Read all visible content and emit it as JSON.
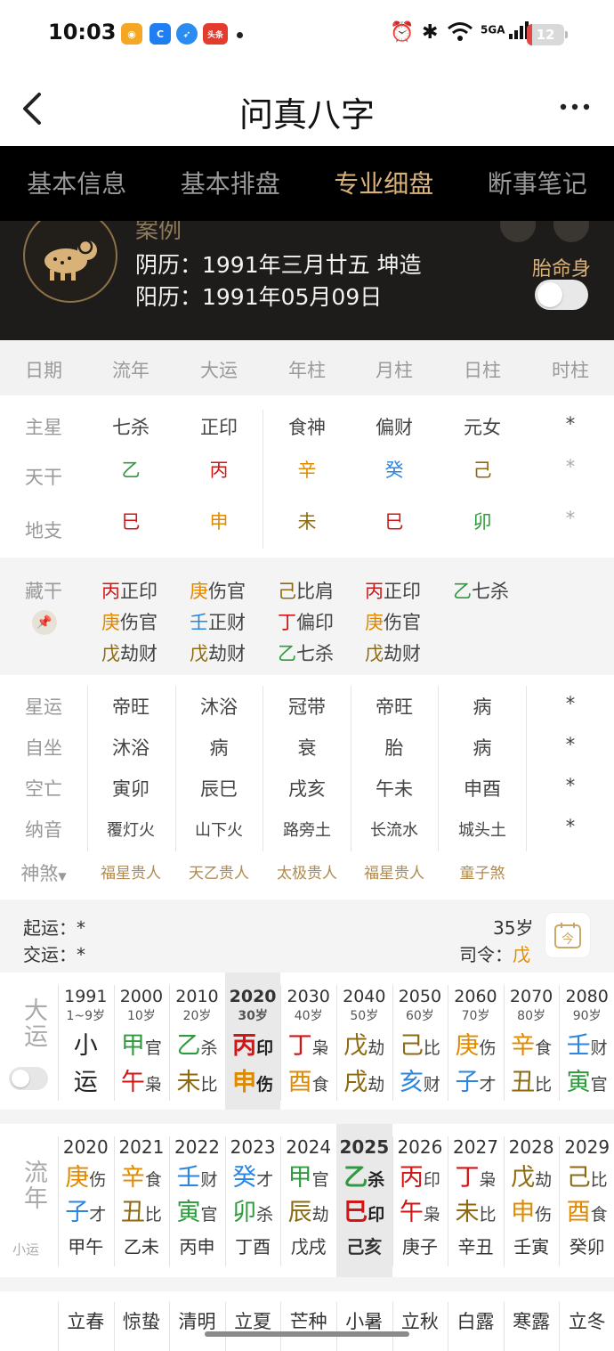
{
  "status_bar": {
    "time": "10:03",
    "apps": [
      {
        "icon": "weibo-icon",
        "color": "#f5a623"
      },
      {
        "icon": "app-c-icon",
        "color": "#1f7ef2"
      },
      {
        "icon": "app-feather-icon",
        "color": "#2a8cf0"
      },
      {
        "icon": "toutiao-icon",
        "color": "#e33b2e",
        "text": "头条"
      }
    ],
    "network": "5GA",
    "battery": "12"
  },
  "nav": {
    "title": "问真八字"
  },
  "tabs": [
    "基本信息",
    "基本排盘",
    "专业细盘",
    "断事笔记"
  ],
  "active_tab": 2,
  "profile": {
    "name": "案例",
    "lunar": "阴历：1991年三月廿五 坤造",
    "solar": "阳历：1991年05月09日",
    "fetal_label": "胎命身",
    "fetal_on": false,
    "zodiac_icon": "ram-icon"
  },
  "columns": [
    "日期",
    "流年",
    "大运",
    "年柱",
    "月柱",
    "日柱",
    "时柱"
  ],
  "row_labels": {
    "main_star": "主星",
    "stem": "天干",
    "branch": "地支",
    "hidden": "藏干"
  },
  "main_star": [
    "七杀",
    "正印",
    "食神",
    "偏财",
    "元女",
    "*"
  ],
  "stems": [
    {
      "char": "乙",
      "color": "#2f9a3e"
    },
    {
      "char": "丙",
      "color": "#d21616"
    },
    {
      "char": "辛",
      "color": "#e08a00"
    },
    {
      "char": "癸",
      "color": "#2a86e0"
    },
    {
      "char": "己",
      "color": "#8d6a10"
    },
    {
      "char": "*",
      "color": "#aaaaaa"
    }
  ],
  "branches": [
    {
      "char": "巳",
      "color": "#d21616"
    },
    {
      "char": "申",
      "color": "#e08a00"
    },
    {
      "char": "未",
      "color": "#8d6a10"
    },
    {
      "char": "巳",
      "color": "#d21616"
    },
    {
      "char": "卯",
      "color": "#2f9a3e"
    },
    {
      "char": "*",
      "color": "#aaaaaa"
    }
  ],
  "hidden_stems": [
    [
      {
        "c": "丙",
        "t": "正印",
        "color": "#d21616"
      },
      {
        "c": "庚",
        "t": "伤官",
        "color": "#e08a00"
      },
      {
        "c": "戊",
        "t": "劫财",
        "color": "#8d6a10"
      }
    ],
    [
      {
        "c": "庚",
        "t": "伤官",
        "color": "#e08a00"
      },
      {
        "c": "壬",
        "t": "正财",
        "color": "#2a86e0"
      },
      {
        "c": "戊",
        "t": "劫财",
        "color": "#8d6a10"
      }
    ],
    [
      {
        "c": "己",
        "t": "比肩",
        "color": "#8d6a10"
      },
      {
        "c": "丁",
        "t": "偏印",
        "color": "#d21616"
      },
      {
        "c": "乙",
        "t": "七杀",
        "color": "#2f9a3e"
      }
    ],
    [
      {
        "c": "丙",
        "t": "正印",
        "color": "#d21616"
      },
      {
        "c": "庚",
        "t": "伤官",
        "color": "#e08a00"
      },
      {
        "c": "戊",
        "t": "劫财",
        "color": "#8d6a10"
      }
    ],
    [
      {
        "c": "乙",
        "t": "七杀",
        "color": "#2f9a3e"
      }
    ]
  ],
  "star_rows": [
    {
      "label": "星运",
      "values": [
        "帝旺",
        "沐浴",
        "冠带",
        "帝旺",
        "病",
        "*"
      ]
    },
    {
      "label": "自坐",
      "values": [
        "沐浴",
        "病",
        "衰",
        "胎",
        "病",
        "*"
      ]
    },
    {
      "label": "空亡",
      "values": [
        "寅卯",
        "辰巳",
        "戌亥",
        "午未",
        "申酉",
        "*"
      ]
    },
    {
      "label": "纳音",
      "values": [
        "覆灯火",
        "山下火",
        "路旁土",
        "长流水",
        "城头土",
        "*"
      ]
    }
  ],
  "shensha": {
    "label": "神煞",
    "values": [
      "福星贵人",
      "天乙贵人",
      "太极贵人",
      "福星贵人",
      "童子煞"
    ]
  },
  "luck_info": {
    "start_luck": "起运：*",
    "hand_over": "交运：*",
    "age": "35岁",
    "commander_label": "司令：",
    "commander_value": "戊",
    "today_label": "今"
  },
  "dayun": {
    "label": "大运",
    "toggle_on": false,
    "items": [
      {
        "year": "1991",
        "age": "1~9岁",
        "top": "小",
        "bottom": "运",
        "top_color": "#222222",
        "bottom_color": "#222222",
        "top_ss": "",
        "bottom_ss": ""
      },
      {
        "year": "2000",
        "age": "10岁",
        "top": "甲",
        "top_ss": "官",
        "bottom": "午",
        "bottom_ss": "枭",
        "top_color": "#2f9a3e",
        "bottom_color": "#d21616"
      },
      {
        "year": "2010",
        "age": "20岁",
        "top": "乙",
        "top_ss": "杀",
        "bottom": "未",
        "bottom_ss": "比",
        "top_color": "#2f9a3e",
        "bottom_color": "#8d6a10"
      },
      {
        "year": "2020",
        "age": "30岁",
        "top": "丙",
        "top_ss": "印",
        "bottom": "申",
        "bottom_ss": "伤",
        "top_color": "#d21616",
        "bottom_color": "#e08a00",
        "current": true
      },
      {
        "year": "2030",
        "age": "40岁",
        "top": "丁",
        "top_ss": "枭",
        "bottom": "酉",
        "bottom_ss": "食",
        "top_color": "#d21616",
        "bottom_color": "#e08a00"
      },
      {
        "year": "2040",
        "age": "50岁",
        "top": "戊",
        "top_ss": "劫",
        "bottom": "戌",
        "bottom_ss": "劫",
        "top_color": "#8d6a10",
        "bottom_color": "#8d6a10"
      },
      {
        "year": "2050",
        "age": "60岁",
        "top": "己",
        "top_ss": "比",
        "bottom": "亥",
        "bottom_ss": "财",
        "top_color": "#8d6a10",
        "bottom_color": "#2a86e0"
      },
      {
        "year": "2060",
        "age": "70岁",
        "top": "庚",
        "top_ss": "伤",
        "bottom": "子",
        "bottom_ss": "才",
        "top_color": "#e08a00",
        "bottom_color": "#2a86e0"
      },
      {
        "year": "2070",
        "age": "80岁",
        "top": "辛",
        "top_ss": "食",
        "bottom": "丑",
        "bottom_ss": "比",
        "top_color": "#e08a00",
        "bottom_color": "#8d6a10"
      },
      {
        "year": "2080",
        "age": "90岁",
        "top": "壬",
        "top_ss": "财",
        "bottom": "寅",
        "bottom_ss": "官",
        "top_color": "#2a86e0",
        "bottom_color": "#2f9a3e"
      }
    ]
  },
  "liunian": {
    "label": "流年",
    "sub_label": "小运",
    "items": [
      {
        "year": "2020",
        "top": "庚",
        "top_ss": "伤",
        "bottom": "子",
        "bottom_ss": "才",
        "top_color": "#e08a00",
        "bottom_color": "#2a86e0",
        "xiaoyun": "甲午"
      },
      {
        "year": "2021",
        "top": "辛",
        "top_ss": "食",
        "bottom": "丑",
        "bottom_ss": "比",
        "top_color": "#e08a00",
        "bottom_color": "#8d6a10",
        "xiaoyun": "乙未"
      },
      {
        "year": "2022",
        "top": "壬",
        "top_ss": "财",
        "bottom": "寅",
        "bottom_ss": "官",
        "top_color": "#2a86e0",
        "bottom_color": "#2f9a3e",
        "xiaoyun": "丙申"
      },
      {
        "year": "2023",
        "top": "癸",
        "top_ss": "才",
        "bottom": "卯",
        "bottom_ss": "杀",
        "top_color": "#2a86e0",
        "bottom_color": "#2f9a3e",
        "xiaoyun": "丁酉"
      },
      {
        "year": "2024",
        "top": "甲",
        "top_ss": "官",
        "bottom": "辰",
        "bottom_ss": "劫",
        "top_color": "#2f9a3e",
        "bottom_color": "#8d6a10",
        "xiaoyun": "戊戌"
      },
      {
        "year": "2025",
        "top": "乙",
        "top_ss": "杀",
        "bottom": "巳",
        "bottom_ss": "印",
        "top_color": "#2f9a3e",
        "bottom_color": "#d21616",
        "xiaoyun": "己亥",
        "current": true
      },
      {
        "year": "2026",
        "top": "丙",
        "top_ss": "印",
        "bottom": "午",
        "bottom_ss": "枭",
        "top_color": "#d21616",
        "bottom_color": "#d21616",
        "xiaoyun": "庚子"
      },
      {
        "year": "2027",
        "top": "丁",
        "top_ss": "枭",
        "bottom": "未",
        "bottom_ss": "比",
        "top_color": "#d21616",
        "bottom_color": "#8d6a10",
        "xiaoyun": "辛丑"
      },
      {
        "year": "2028",
        "top": "戊",
        "top_ss": "劫",
        "bottom": "申",
        "bottom_ss": "伤",
        "top_color": "#8d6a10",
        "bottom_color": "#e08a00",
        "xiaoyun": "壬寅"
      },
      {
        "year": "2029",
        "top": "己",
        "top_ss": "比",
        "bottom": "酉",
        "bottom_ss": "食",
        "top_color": "#8d6a10",
        "bottom_color": "#e08a00",
        "xiaoyun": "癸卯"
      }
    ]
  },
  "solar_terms": [
    "立春",
    "惊蛰",
    "清明",
    "立夏",
    "芒种",
    "小暑",
    "立秋",
    "白露",
    "寒露",
    "立冬"
  ]
}
